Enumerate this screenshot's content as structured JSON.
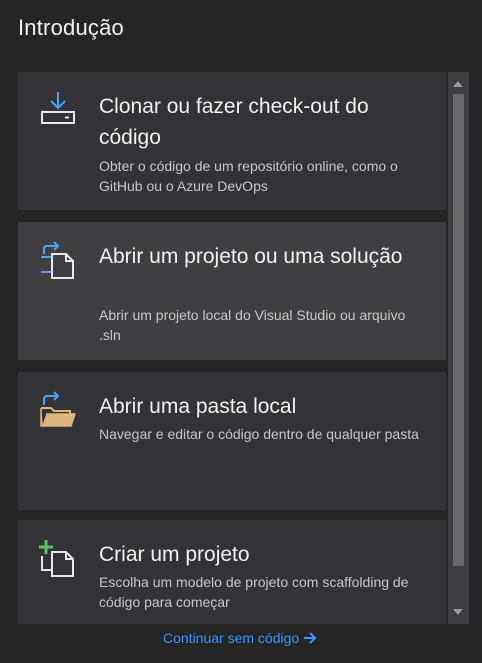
{
  "header": {
    "title": "Introdução"
  },
  "cards": [
    {
      "title": "Clonar ou fazer check-out do código",
      "description": "Obter o código de um repositório online, como o GitHub ou o Azure DevOps",
      "icon": "download-clone-icon"
    },
    {
      "title": "Abrir um projeto ou uma solução",
      "description": "Abrir um projeto local do Visual Studio ou arquivo .sln",
      "icon": "open-project-icon"
    },
    {
      "title": "Abrir uma pasta local",
      "description": "Navegar e editar o código dentro de qualquer pasta",
      "icon": "open-folder-icon"
    },
    {
      "title": "Criar um projeto",
      "description": "Escolha um modelo de projeto com scaffolding de código para começar",
      "icon": "new-project-icon"
    }
  ],
  "footer": {
    "continue_label": "Continuar sem código"
  },
  "colors": {
    "background": "#252526",
    "card": "#333337",
    "card_hover": "#3f3f41",
    "accent_blue": "#3794ff",
    "icon_blue": "#4aa3ff",
    "icon_green": "#57c45a",
    "folder_yellow": "#dcb67a"
  }
}
